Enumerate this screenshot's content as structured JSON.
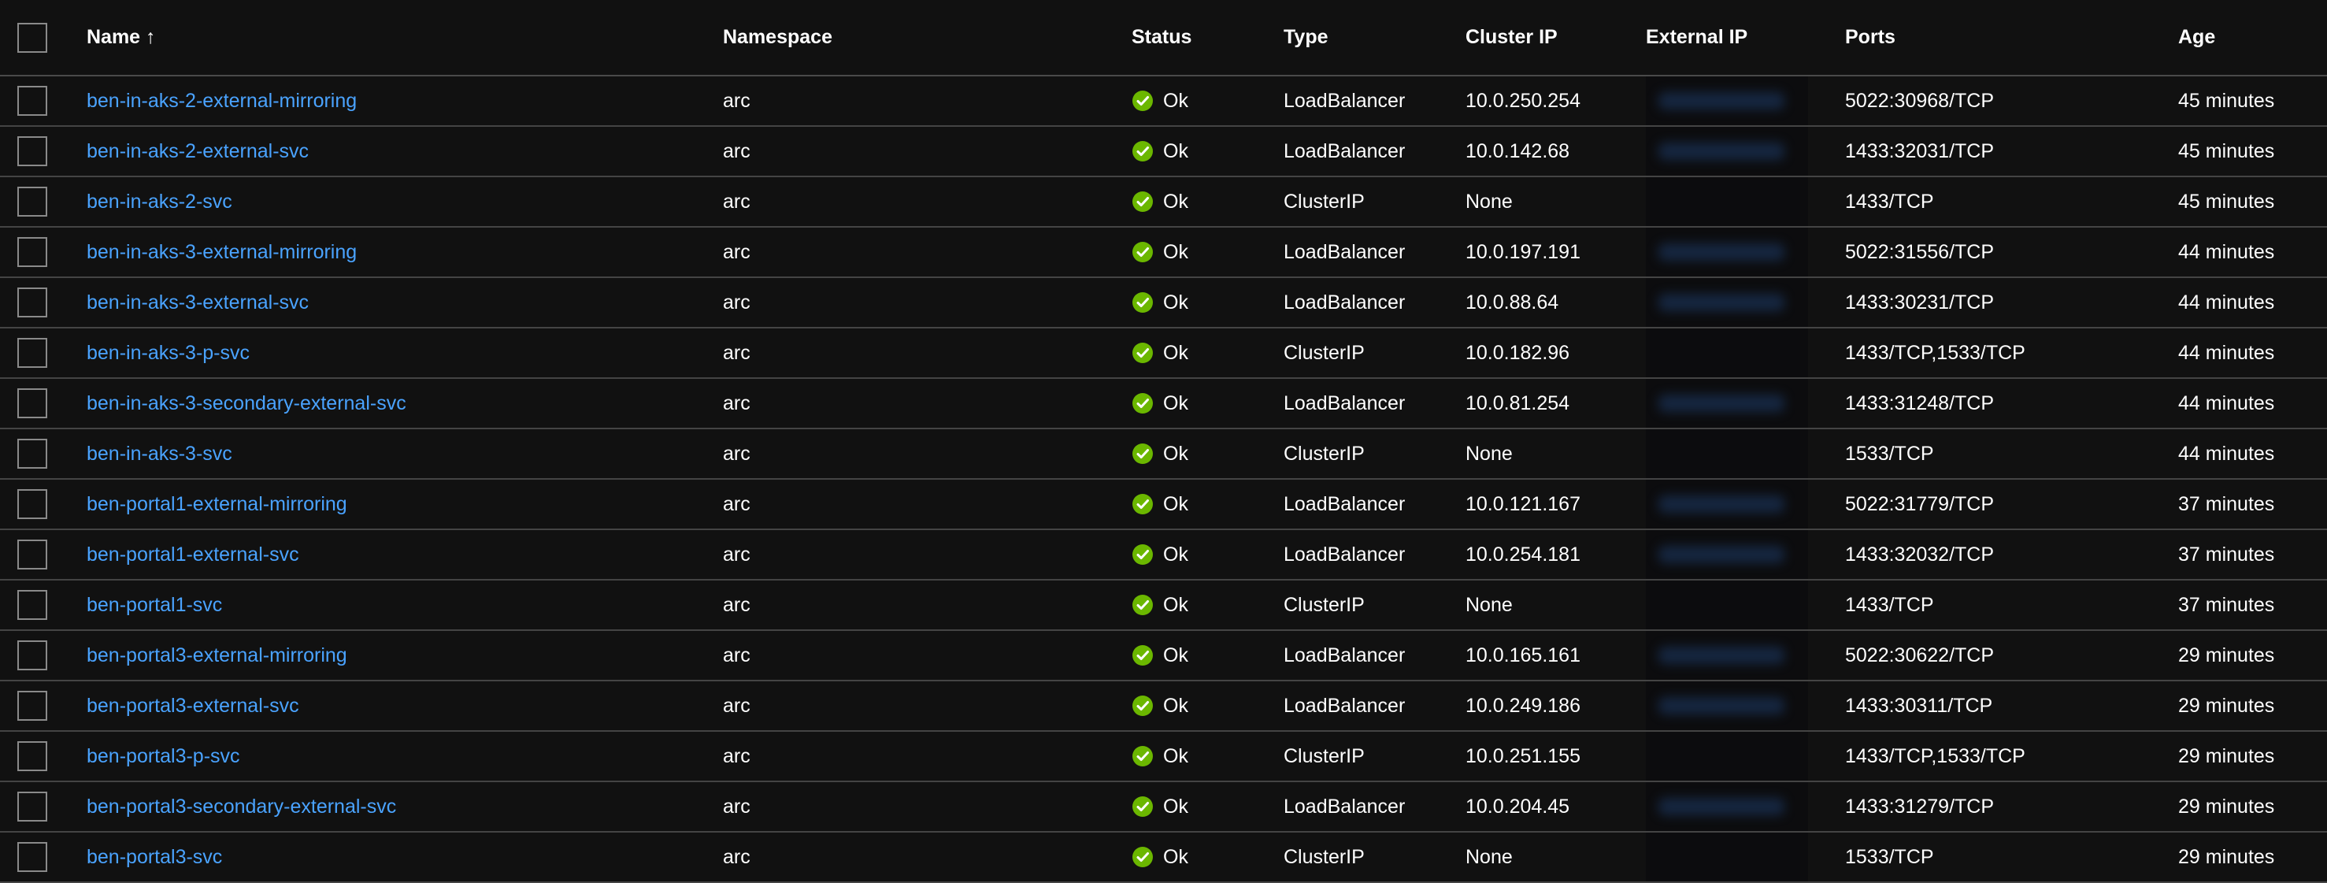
{
  "columns": {
    "name": "Name ↑",
    "namespace": "Namespace",
    "status": "Status",
    "type": "Type",
    "cluster_ip": "Cluster IP",
    "external_ip": "External IP",
    "ports": "Ports",
    "age": "Age"
  },
  "status_icon": "check-circle-icon",
  "colors": {
    "link": "#4aa3ff",
    "status_ok": "#6bb700",
    "background": "#111111"
  },
  "rows": [
    {
      "name": "ben-in-aks-2-external-mirroring",
      "namespace": "arc",
      "status": "Ok",
      "type": "LoadBalancer",
      "cluster_ip": "10.0.250.254",
      "external_ip_redacted": true,
      "ports": "5022:30968/TCP",
      "age": "45 minutes"
    },
    {
      "name": "ben-in-aks-2-external-svc",
      "namespace": "arc",
      "status": "Ok",
      "type": "LoadBalancer",
      "cluster_ip": "10.0.142.68",
      "external_ip_redacted": true,
      "ports": "1433:32031/TCP",
      "age": "45 minutes"
    },
    {
      "name": "ben-in-aks-2-svc",
      "namespace": "arc",
      "status": "Ok",
      "type": "ClusterIP",
      "cluster_ip": "None",
      "external_ip_redacted": false,
      "ports": "1433/TCP",
      "age": "45 minutes"
    },
    {
      "name": "ben-in-aks-3-external-mirroring",
      "namespace": "arc",
      "status": "Ok",
      "type": "LoadBalancer",
      "cluster_ip": "10.0.197.191",
      "external_ip_redacted": true,
      "ports": "5022:31556/TCP",
      "age": "44 minutes"
    },
    {
      "name": "ben-in-aks-3-external-svc",
      "namespace": "arc",
      "status": "Ok",
      "type": "LoadBalancer",
      "cluster_ip": "10.0.88.64",
      "external_ip_redacted": true,
      "ports": "1433:30231/TCP",
      "age": "44 minutes"
    },
    {
      "name": "ben-in-aks-3-p-svc",
      "namespace": "arc",
      "status": "Ok",
      "type": "ClusterIP",
      "cluster_ip": "10.0.182.96",
      "external_ip_redacted": false,
      "ports": "1433/TCP,1533/TCP",
      "age": "44 minutes"
    },
    {
      "name": "ben-in-aks-3-secondary-external-svc",
      "namespace": "arc",
      "status": "Ok",
      "type": "LoadBalancer",
      "cluster_ip": "10.0.81.254",
      "external_ip_redacted": true,
      "ports": "1433:31248/TCP",
      "age": "44 minutes"
    },
    {
      "name": "ben-in-aks-3-svc",
      "namespace": "arc",
      "status": "Ok",
      "type": "ClusterIP",
      "cluster_ip": "None",
      "external_ip_redacted": false,
      "ports": "1533/TCP",
      "age": "44 minutes"
    },
    {
      "name": "ben-portal1-external-mirroring",
      "namespace": "arc",
      "status": "Ok",
      "type": "LoadBalancer",
      "cluster_ip": "10.0.121.167",
      "external_ip_redacted": true,
      "ports": "5022:31779/TCP",
      "age": "37 minutes"
    },
    {
      "name": "ben-portal1-external-svc",
      "namespace": "arc",
      "status": "Ok",
      "type": "LoadBalancer",
      "cluster_ip": "10.0.254.181",
      "external_ip_redacted": true,
      "ports": "1433:32032/TCP",
      "age": "37 minutes"
    },
    {
      "name": "ben-portal1-svc",
      "namespace": "arc",
      "status": "Ok",
      "type": "ClusterIP",
      "cluster_ip": "None",
      "external_ip_redacted": false,
      "ports": "1433/TCP",
      "age": "37 minutes"
    },
    {
      "name": "ben-portal3-external-mirroring",
      "namespace": "arc",
      "status": "Ok",
      "type": "LoadBalancer",
      "cluster_ip": "10.0.165.161",
      "external_ip_redacted": true,
      "ports": "5022:30622/TCP",
      "age": "29 minutes"
    },
    {
      "name": "ben-portal3-external-svc",
      "namespace": "arc",
      "status": "Ok",
      "type": "LoadBalancer",
      "cluster_ip": "10.0.249.186",
      "external_ip_redacted": true,
      "ports": "1433:30311/TCP",
      "age": "29 minutes"
    },
    {
      "name": "ben-portal3-p-svc",
      "namespace": "arc",
      "status": "Ok",
      "type": "ClusterIP",
      "cluster_ip": "10.0.251.155",
      "external_ip_redacted": false,
      "ports": "1433/TCP,1533/TCP",
      "age": "29 minutes"
    },
    {
      "name": "ben-portal3-secondary-external-svc",
      "namespace": "arc",
      "status": "Ok",
      "type": "LoadBalancer",
      "cluster_ip": "10.0.204.45",
      "external_ip_redacted": true,
      "ports": "1433:31279/TCP",
      "age": "29 minutes"
    },
    {
      "name": "ben-portal3-svc",
      "namespace": "arc",
      "status": "Ok",
      "type": "ClusterIP",
      "cluster_ip": "None",
      "external_ip_redacted": false,
      "ports": "1533/TCP",
      "age": "29 minutes"
    }
  ]
}
